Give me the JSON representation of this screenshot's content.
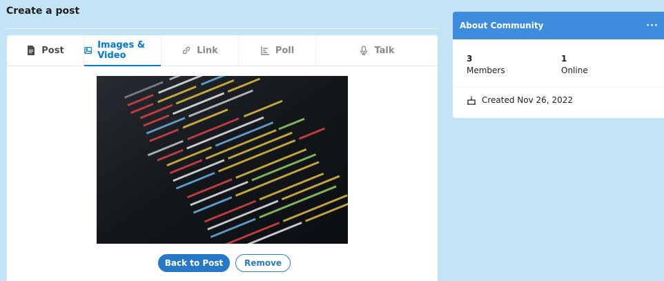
{
  "page": {
    "title": "Create a post"
  },
  "tabs": [
    {
      "label": "Post",
      "icon": "document-icon"
    },
    {
      "label": "Images & Video",
      "icon": "image-icon",
      "active": true
    },
    {
      "label": "Link",
      "icon": "link-icon"
    },
    {
      "label": "Poll",
      "icon": "poll-icon"
    },
    {
      "label": "Talk",
      "icon": "microphone-icon"
    }
  ],
  "buttons": {
    "back": "Back to Post",
    "remove": "Remove"
  },
  "about": {
    "title": "About Community",
    "menu": "···",
    "members_count": "3",
    "members_label": "Members",
    "online_count": "1",
    "online_label": "Online",
    "created": "Created Nov 26, 2022"
  },
  "colors": {
    "background": "#c3e3f7",
    "accent": "#0079d3",
    "header": "#3e8cdd",
    "button": "#2878c8"
  }
}
